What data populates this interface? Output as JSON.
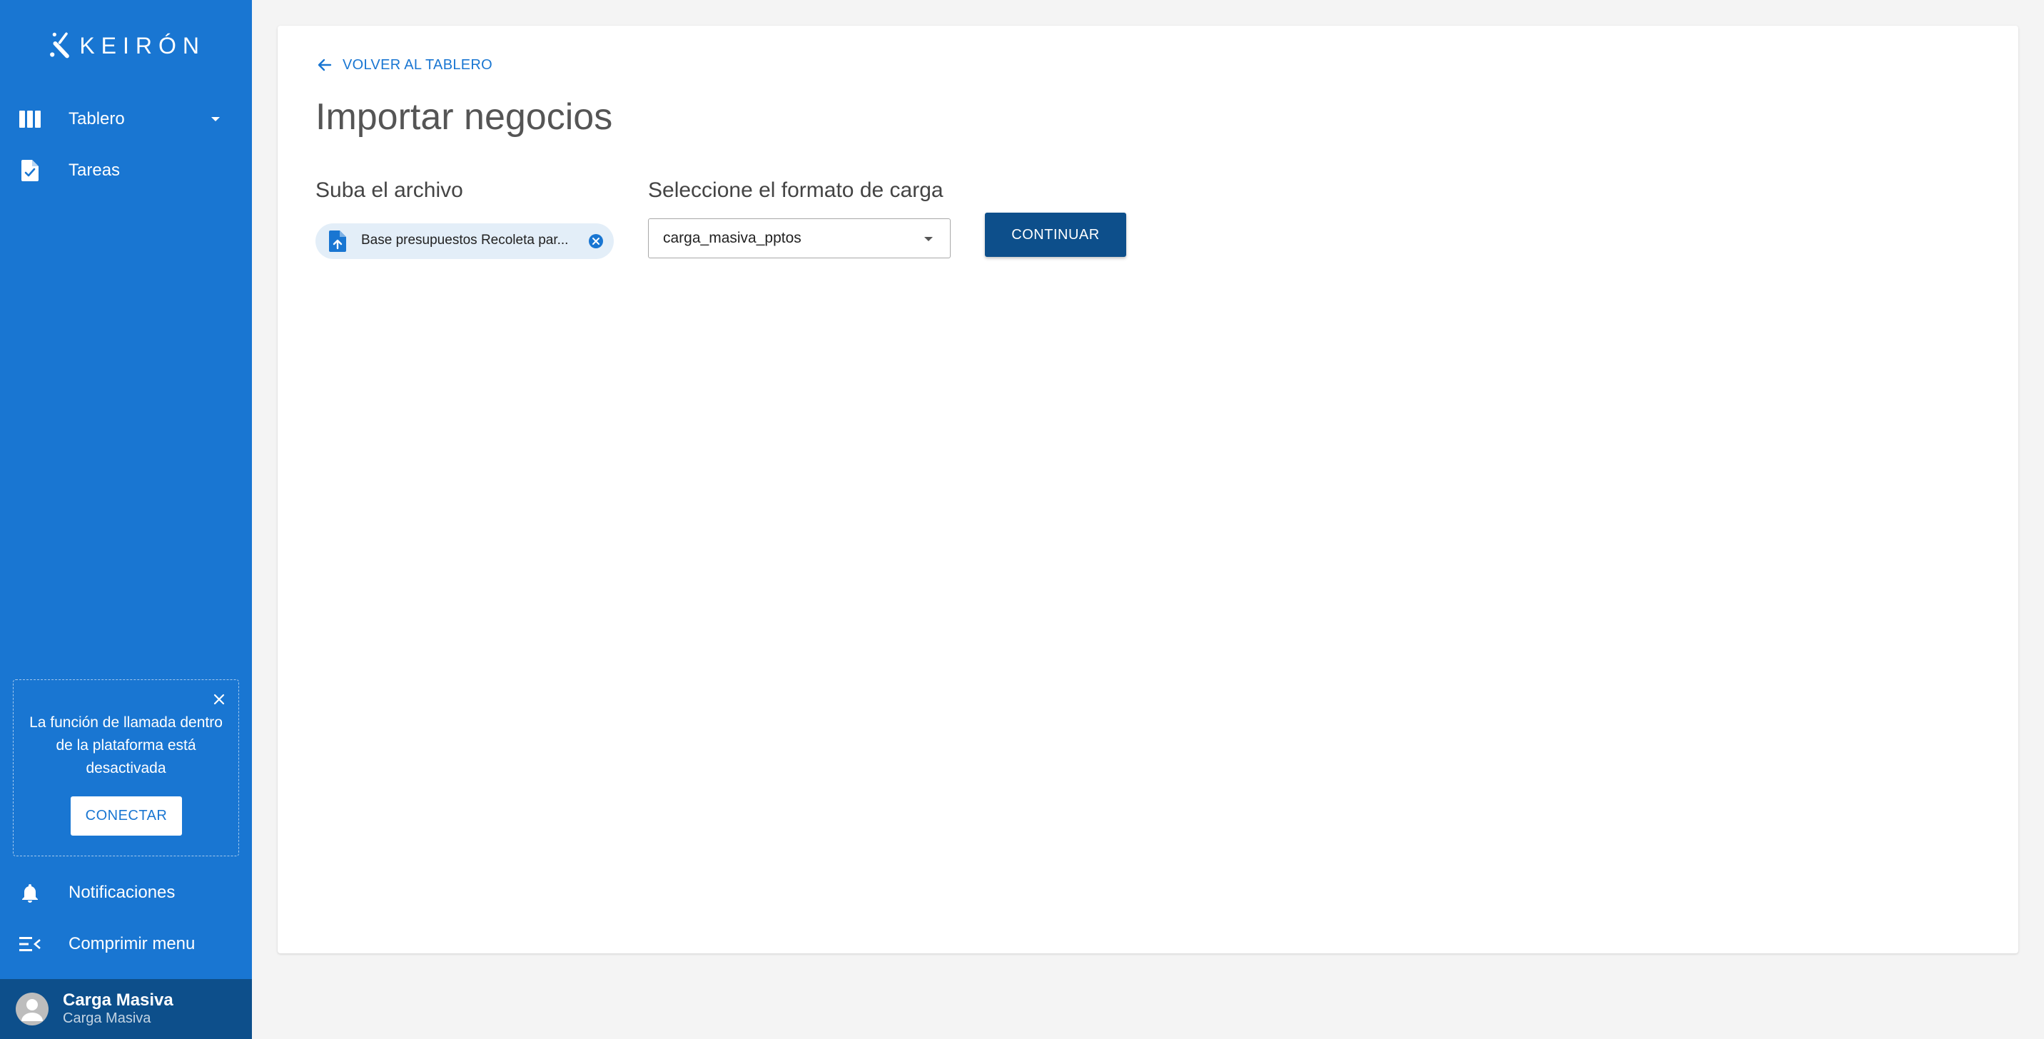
{
  "brand": {
    "logo_text": "KEIRÓN"
  },
  "sidebar": {
    "items": [
      {
        "label": "Tablero",
        "icon": "board-columns-icon",
        "has_dropdown": true
      },
      {
        "label": "Tareas",
        "icon": "task-document-icon"
      }
    ],
    "call_notice": {
      "message": "La función de llamada dentro de la plataforma está desactivada",
      "button_label": "CONECTAR",
      "close_icon": "close-icon"
    },
    "bottom_items": [
      {
        "label": "Notificaciones",
        "icon": "bell-icon"
      },
      {
        "label": "Comprimir menu",
        "icon": "collapse-menu-icon"
      }
    ],
    "user": {
      "name": "Carga Masiva",
      "subtitle": "Carga Masiva"
    }
  },
  "main": {
    "back_link": "VOLVER AL TABLERO",
    "title": "Importar negocios",
    "upload": {
      "label": "Suba el archivo",
      "file_name": "Base presupuestos Recoleta par..."
    },
    "format": {
      "label": "Seleccione el formato de carga",
      "selected": "carga_masiva_pptos"
    },
    "continue_label": "CONTINUAR"
  },
  "colors": {
    "sidebar_bg": "#1976d2",
    "user_bar_bg": "#0d4f8b",
    "primary_button": "#0d4f8b",
    "page_bg": "#f4f4f4",
    "chip_bg": "#e3eef8"
  }
}
